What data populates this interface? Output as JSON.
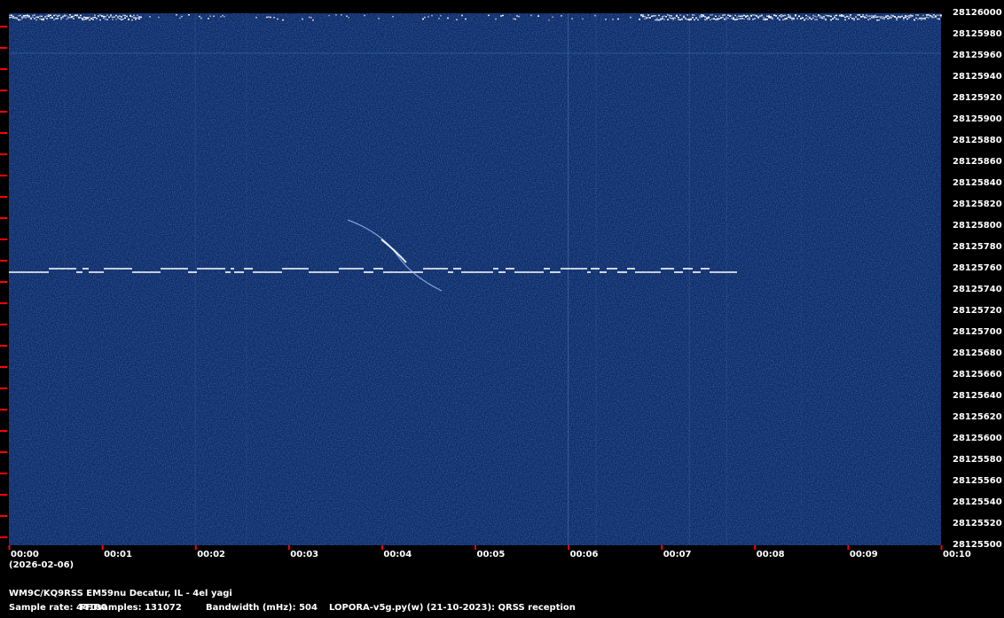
{
  "chart_data": {
    "type": "heatmap",
    "title": "",
    "xlabel": "",
    "ylabel": "",
    "x_ticks": [
      "00:00",
      "00:01",
      "00:02",
      "00:03",
      "00:04",
      "00:05",
      "00:06",
      "00:07",
      "00:08",
      "00:09",
      "00:10"
    ],
    "x_range_minutes": [
      0,
      10
    ],
    "y_ticks": [
      28126000,
      28125980,
      28125960,
      28125940,
      28125920,
      28125900,
      28125880,
      28125860,
      28125840,
      28125820,
      28125800,
      28125780,
      28125760,
      28125740,
      28125720,
      28125700,
      28125680,
      28125660,
      28125640,
      28125620,
      28125600,
      28125580,
      28125560,
      28125540,
      28125520,
      28125500
    ],
    "y_range_hz": [
      28125500,
      28126000
    ],
    "signal": {
      "description_free": true,
      "base_freq_hz": 28125760,
      "shift_hz": 1,
      "start_min": 0.0,
      "end_min": 7.75
    },
    "colors": {
      "background": "#0c2a66",
      "noise_hi": "#1f4a9a",
      "signal": "#ffffff",
      "tick": "#ff0000"
    }
  },
  "date": "(2026-02-06)",
  "station": "WM9C/KQ9RSS EM59nu Decatur, IL - 4el yagi",
  "footer": {
    "sample_rate": "Sample rate: 44100",
    "fft": "FFTsamples: 131072",
    "bandwidth": "Bandwidth (mHz): 504",
    "software": "LOPORA-v5g.py(w) (21-10-2023): QRSS reception"
  }
}
